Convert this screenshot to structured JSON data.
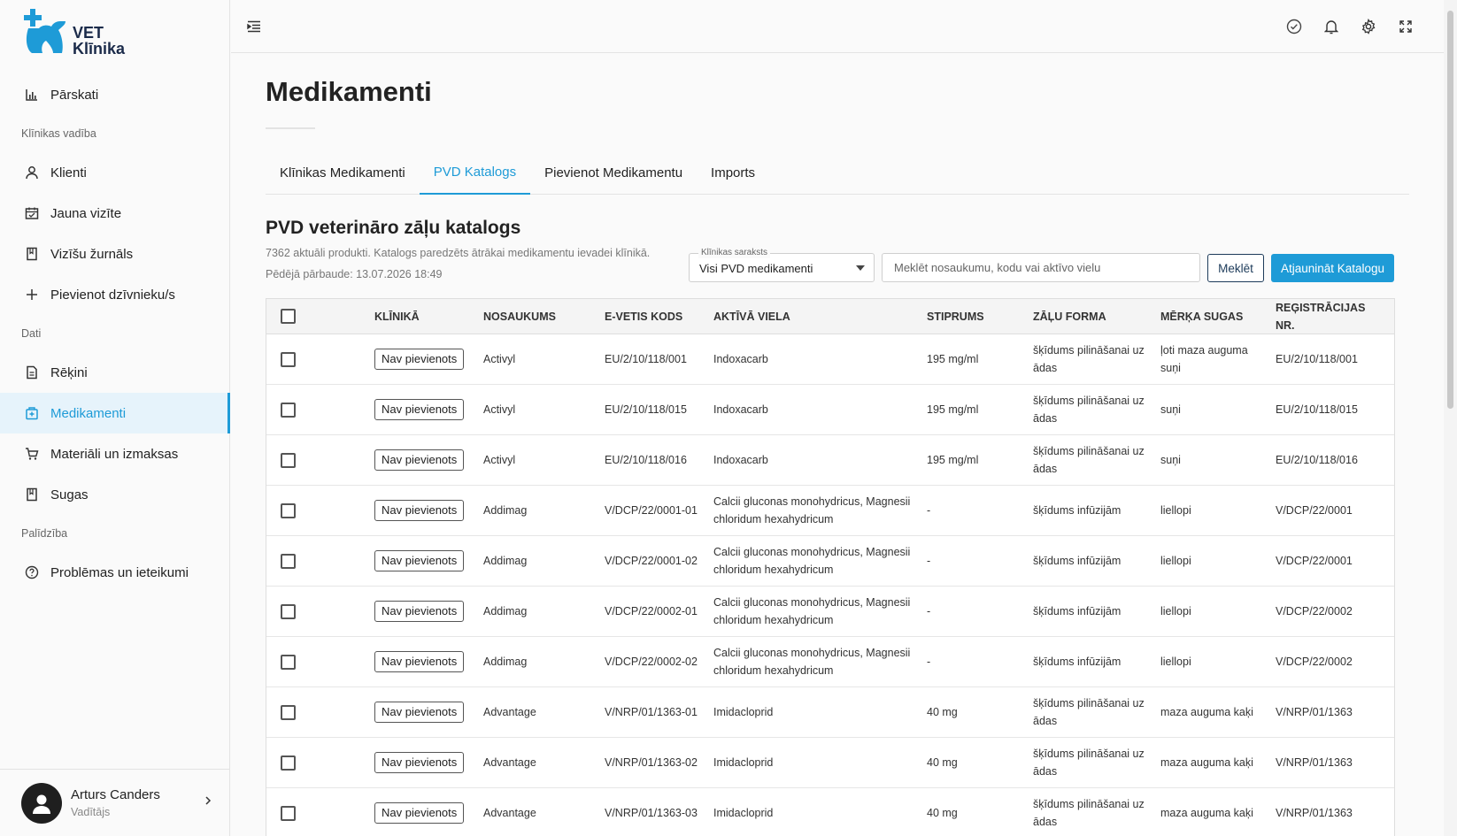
{
  "app": {
    "logo_text_line1": "VET",
    "logo_text_line2": "Klīnika",
    "brand_color": "#1e9bd7"
  },
  "sidebar": {
    "items": [
      {
        "label": "Pārskati",
        "icon": "bar-chart-icon"
      },
      {
        "section": "Klīnikas vadība"
      },
      {
        "label": "Klienti",
        "icon": "user-icon"
      },
      {
        "label": "Jauna vizīte",
        "icon": "calendar-icon"
      },
      {
        "label": "Vizīšu žurnāls",
        "icon": "book-icon"
      },
      {
        "label": "Pievienot dzīvnieku/s",
        "icon": "plus-icon"
      },
      {
        "section": "Dati"
      },
      {
        "label": "Rēķini",
        "icon": "invoice-icon"
      },
      {
        "label": "Medikamenti",
        "icon": "medicine-icon",
        "active": true
      },
      {
        "label": "Materiāli un izmaksas",
        "icon": "cart-icon"
      },
      {
        "label": "Sugas",
        "icon": "book-icon"
      },
      {
        "section": "Palīdzība"
      },
      {
        "label": "Problēmas un ieteikumi",
        "icon": "help-icon"
      }
    ],
    "user": {
      "name": "Arturs Canders",
      "role": "Vadītājs"
    }
  },
  "page": {
    "title": "Medikamenti",
    "tabs": [
      "Klīnikas Medikamenti",
      "PVD Katalogs",
      "Pievienot Medikamentu",
      "Imports"
    ],
    "active_tab": "PVD Katalogs"
  },
  "catalog": {
    "title": "PVD veterināro zāļu katalogs",
    "subtitle": "7362 aktuāli produkti. Katalogs paredzēts ātrākai medikamentu ievadei klīnikā.",
    "last_checked": "Pēdējā pārbaude: 13.07.2026 18:49",
    "select_label": "Klīnikas saraksts",
    "select_value": "Visi PVD medikamenti",
    "search_placeholder": "Meklēt nosaukumu, kodu vai aktīvo vielu",
    "search_value": "",
    "search_button": "Meklēt",
    "update_button": "Atjaunināt Katalogu"
  },
  "table": {
    "headers": [
      "KLĪNIKĀ",
      "NOSAUKUMS",
      "E-VETIS KODS",
      "AKTĪVĀ VIELA",
      "STIPRUMS",
      "ZĀĻU FORMA",
      "MĒRĶA SUGAS",
      "REĢISTRĀCIJAS NR."
    ],
    "rows": [
      {
        "status": "Nav pievienots",
        "name": "Activyl",
        "code": "EU/2/10/118/001",
        "substance": "Indoxacarb",
        "strength": "195 mg/ml",
        "form": "šķīdums pilināšanai uz ādas",
        "species": "ļoti maza auguma suņi",
        "reg": "EU/2/10/118/001"
      },
      {
        "status": "Nav pievienots",
        "name": "Activyl",
        "code": "EU/2/10/118/015",
        "substance": "Indoxacarb",
        "strength": "195 mg/ml",
        "form": "šķīdums pilināšanai uz ādas",
        "species": "suņi",
        "reg": "EU/2/10/118/015"
      },
      {
        "status": "Nav pievienots",
        "name": "Activyl",
        "code": "EU/2/10/118/016",
        "substance": "Indoxacarb",
        "strength": "195 mg/ml",
        "form": "šķīdums pilināšanai uz ādas",
        "species": "suņi",
        "reg": "EU/2/10/118/016"
      },
      {
        "status": "Nav pievienots",
        "name": "Addimag",
        "code": "V/DCP/22/0001-01",
        "substance": "Calcii gluconas monohydricus, Magnesii chloridum hexahydricum",
        "strength": "-",
        "form": "šķīdums infūzijām",
        "species": "liellopi",
        "reg": "V/DCP/22/0001"
      },
      {
        "status": "Nav pievienots",
        "name": "Addimag",
        "code": "V/DCP/22/0001-02",
        "substance": "Calcii gluconas monohydricus, Magnesii chloridum hexahydricum",
        "strength": "-",
        "form": "šķīdums infūzijām",
        "species": "liellopi",
        "reg": "V/DCP/22/0001"
      },
      {
        "status": "Nav pievienots",
        "name": "Addimag",
        "code": "V/DCP/22/0002-01",
        "substance": "Calcii gluconas monohydricus, Magnesii chloridum hexahydricum",
        "strength": "-",
        "form": "šķīdums infūzijām",
        "species": "liellopi",
        "reg": "V/DCP/22/0002"
      },
      {
        "status": "Nav pievienots",
        "name": "Addimag",
        "code": "V/DCP/22/0002-02",
        "substance": "Calcii gluconas monohydricus, Magnesii chloridum hexahydricum",
        "strength": "-",
        "form": "šķīdums infūzijām",
        "species": "liellopi",
        "reg": "V/DCP/22/0002"
      },
      {
        "status": "Nav pievienots",
        "name": "Advantage",
        "code": "V/NRP/01/1363-01",
        "substance": "Imidacloprid",
        "strength": "40 mg",
        "form": "šķīdums pilināšanai uz ādas",
        "species": "maza auguma kaķi",
        "reg": "V/NRP/01/1363"
      },
      {
        "status": "Nav pievienots",
        "name": "Advantage",
        "code": "V/NRP/01/1363-02",
        "substance": "Imidacloprid",
        "strength": "40 mg",
        "form": "šķīdums pilināšanai uz ādas",
        "species": "maza auguma kaķi",
        "reg": "V/NRP/01/1363"
      },
      {
        "status": "Nav pievienots",
        "name": "Advantage",
        "code": "V/NRP/01/1363-03",
        "substance": "Imidacloprid",
        "strength": "40 mg",
        "form": "šķīdums pilināšanai uz ādas",
        "species": "maza auguma kaķi",
        "reg": "V/NRP/01/1363"
      }
    ]
  }
}
